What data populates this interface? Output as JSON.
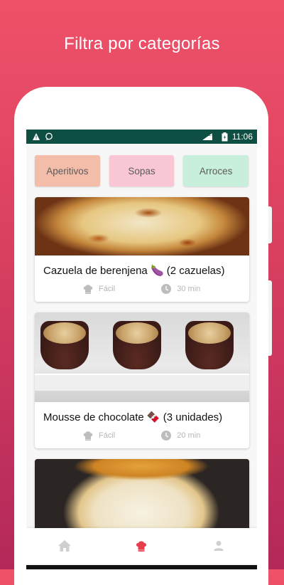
{
  "promo": {
    "title": "Filtra por categorías"
  },
  "statusbar": {
    "time": "11:06",
    "network": "LTE"
  },
  "categories": [
    {
      "label": "Aperitivos",
      "color": "#f3bda9"
    },
    {
      "label": "Sopas",
      "color": "#f9c7d4"
    },
    {
      "label": "Arroces",
      "color": "#c7efdc"
    }
  ],
  "recipes": [
    {
      "title": "Cazuela de berenjena 🍆 (2 cazuelas)",
      "difficulty": "Fácil",
      "time": "30 min"
    },
    {
      "title": "Mousse de chocolate 🍫 (3 unidades)",
      "difficulty": "Fácil",
      "time": "20 min"
    },
    {
      "title": "",
      "difficulty": "",
      "time": ""
    }
  ],
  "bottom_nav": {
    "active": "recipes",
    "active_color": "#e83d4b",
    "inactive_color": "#cfcfcf"
  }
}
